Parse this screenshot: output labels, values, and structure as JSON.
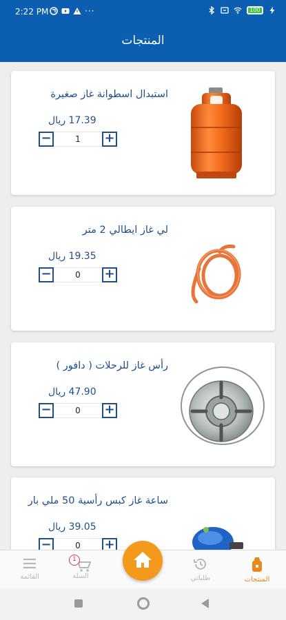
{
  "status_bar": {
    "time": "2:22 PM",
    "battery": "100"
  },
  "app_bar": {
    "title": "المنتجات"
  },
  "products": [
    {
      "title": "استبدال اسطوانة غاز صغيرة",
      "price": "17.39 ريال",
      "quantity": "1",
      "image": "orange-gas-cylinder"
    },
    {
      "title": "لي غاز ايطالي  2 متر",
      "price": "19.35 ريال",
      "quantity": "0",
      "image": "orange-gas-hose"
    },
    {
      "title": "رأس غاز للرحلات ( دافور )",
      "price": "47.90 ريال",
      "quantity": "0",
      "image": "camping-stove-burner"
    },
    {
      "title": "ساعة غاز كبس رأسية 50 ملي بار",
      "price": "39.05 ريال",
      "quantity": "0",
      "image": "blue-gas-regulator"
    }
  ],
  "bottom_nav": {
    "products": "المنتجات",
    "orders": "طلباتي",
    "cart": "السلة",
    "menu": "القائمة",
    "cart_badge": "1"
  },
  "colors": {
    "primary": "#0c5fb0",
    "text_blue": "#1e4f8a",
    "accent_orange": "#f39a1c"
  }
}
